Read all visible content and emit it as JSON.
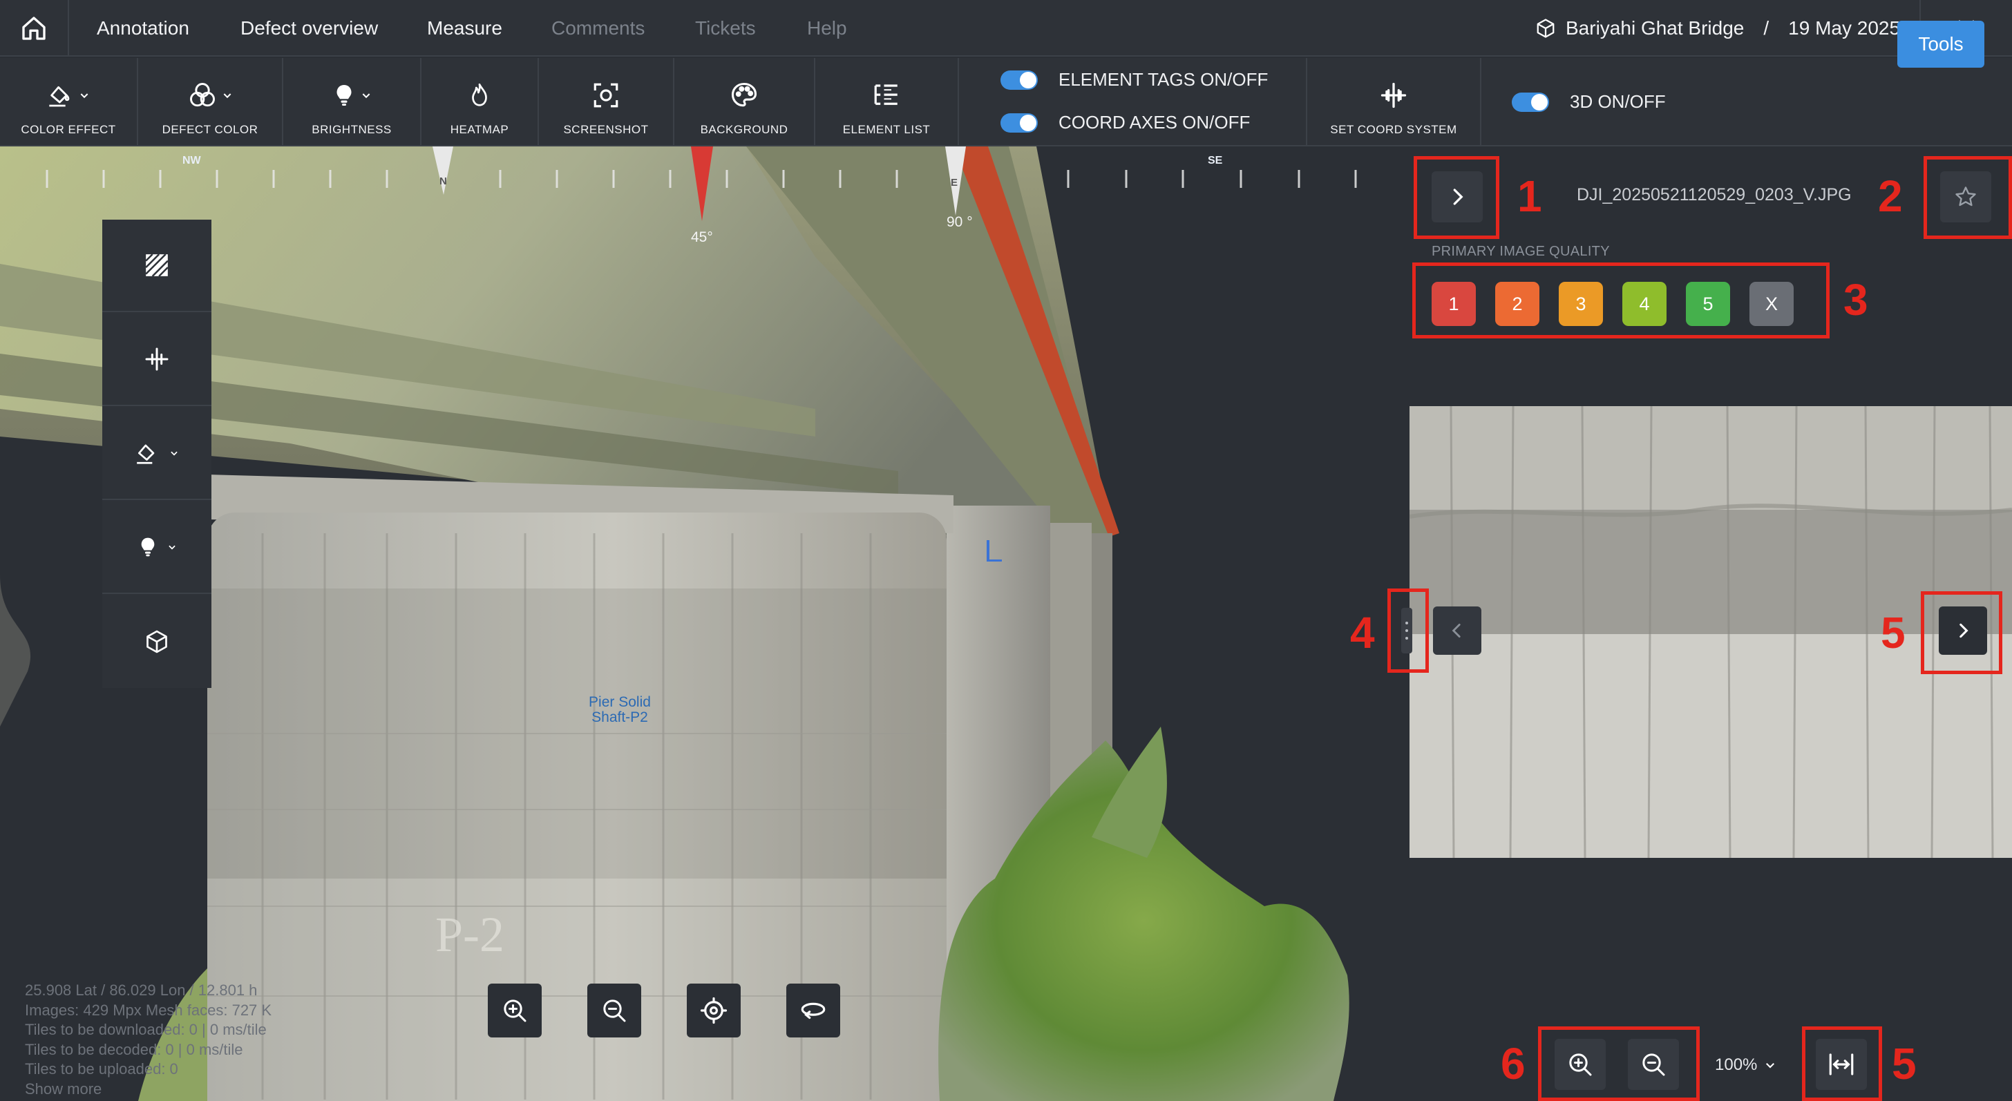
{
  "nav": {
    "home_icon": "home-icon",
    "items": [
      {
        "label": "Annotation",
        "enabled": true
      },
      {
        "label": "Defect overview",
        "enabled": true
      },
      {
        "label": "Measure",
        "enabled": true
      },
      {
        "label": "Comments",
        "enabled": false
      },
      {
        "label": "Tickets",
        "enabled": false
      },
      {
        "label": "Help",
        "enabled": false
      }
    ],
    "project": "Bariyahi Ghat Bridge",
    "separator": "/",
    "date": "19 May 2025",
    "close_icon": "close-icon"
  },
  "toolbar": {
    "tools": [
      {
        "label": "COLOR EFFECT",
        "icon": "paint-bucket-icon"
      },
      {
        "label": "DEFECT COLOR",
        "icon": "color-circles-icon"
      },
      {
        "label": "BRIGHTNESS",
        "icon": "bulb-icon"
      },
      {
        "label": "HEATMAP",
        "icon": "flame-icon"
      },
      {
        "label": "SCREENSHOT",
        "icon": "screenshot-icon"
      },
      {
        "label": "BACKGROUND",
        "icon": "palette-icon"
      },
      {
        "label": "ELEMENT LIST",
        "icon": "list-tree-icon"
      }
    ],
    "toggles": [
      {
        "label": "ELEMENT TAGS ON/OFF",
        "on": true
      },
      {
        "label": "COORD AXES ON/OFF",
        "on": true
      }
    ],
    "set_coord": {
      "label": "SET COORD SYSTEM",
      "icon": "axes-icon"
    },
    "toggle_3d": {
      "label": "3D ON/OFF",
      "on": true
    },
    "tools_button": "Tools"
  },
  "scene": {
    "compass": {
      "nw": "NW",
      "n": "N",
      "e": "E",
      "se": "SE",
      "heading": "45°",
      "east_deg": "90 °"
    },
    "element_tag": "Pier Solid\nShaft-P2",
    "pier_mark": "P-2",
    "side_tools": [
      "hatch-icon",
      "axes-icon",
      "paint-bucket-icon",
      "bulb-icon",
      "cube-icon"
    ],
    "view_controls": [
      "zoom-in-icon",
      "zoom-out-icon",
      "target-icon",
      "orbit-icon"
    ],
    "stats": [
      "25.908 Lat / 86.029 Lon / 12.801 h",
      "Images: 429 Mpx    Mesh faces: 727 K",
      "Tiles to be downloaded: 0 | 0 ms/tile",
      "Tiles to be decoded: 0 | 0 ms/tile",
      "Tiles to be uploaded: 0",
      "Show more"
    ]
  },
  "panel": {
    "filename": "DJI_20250521120529_0203_V.JPG",
    "quality_label": "PRIMARY IMAGE QUALITY",
    "quality_options": [
      {
        "label": "1",
        "color": "#d9473f"
      },
      {
        "label": "2",
        "color": "#ec6a33"
      },
      {
        "label": "3",
        "color": "#eb9a26"
      },
      {
        "label": "4",
        "color": "#8fbd2c"
      },
      {
        "label": "5",
        "color": "#45b04c"
      },
      {
        "label": "X",
        "color": "#6a6e75"
      }
    ],
    "zoom_level": "100%",
    "callouts": [
      "1",
      "2",
      "3",
      "4",
      "5",
      "5",
      "6"
    ]
  },
  "colors": {
    "accent": "#3b8ee0",
    "callout_red": "#e5261d",
    "bg": "#2b2f35"
  }
}
